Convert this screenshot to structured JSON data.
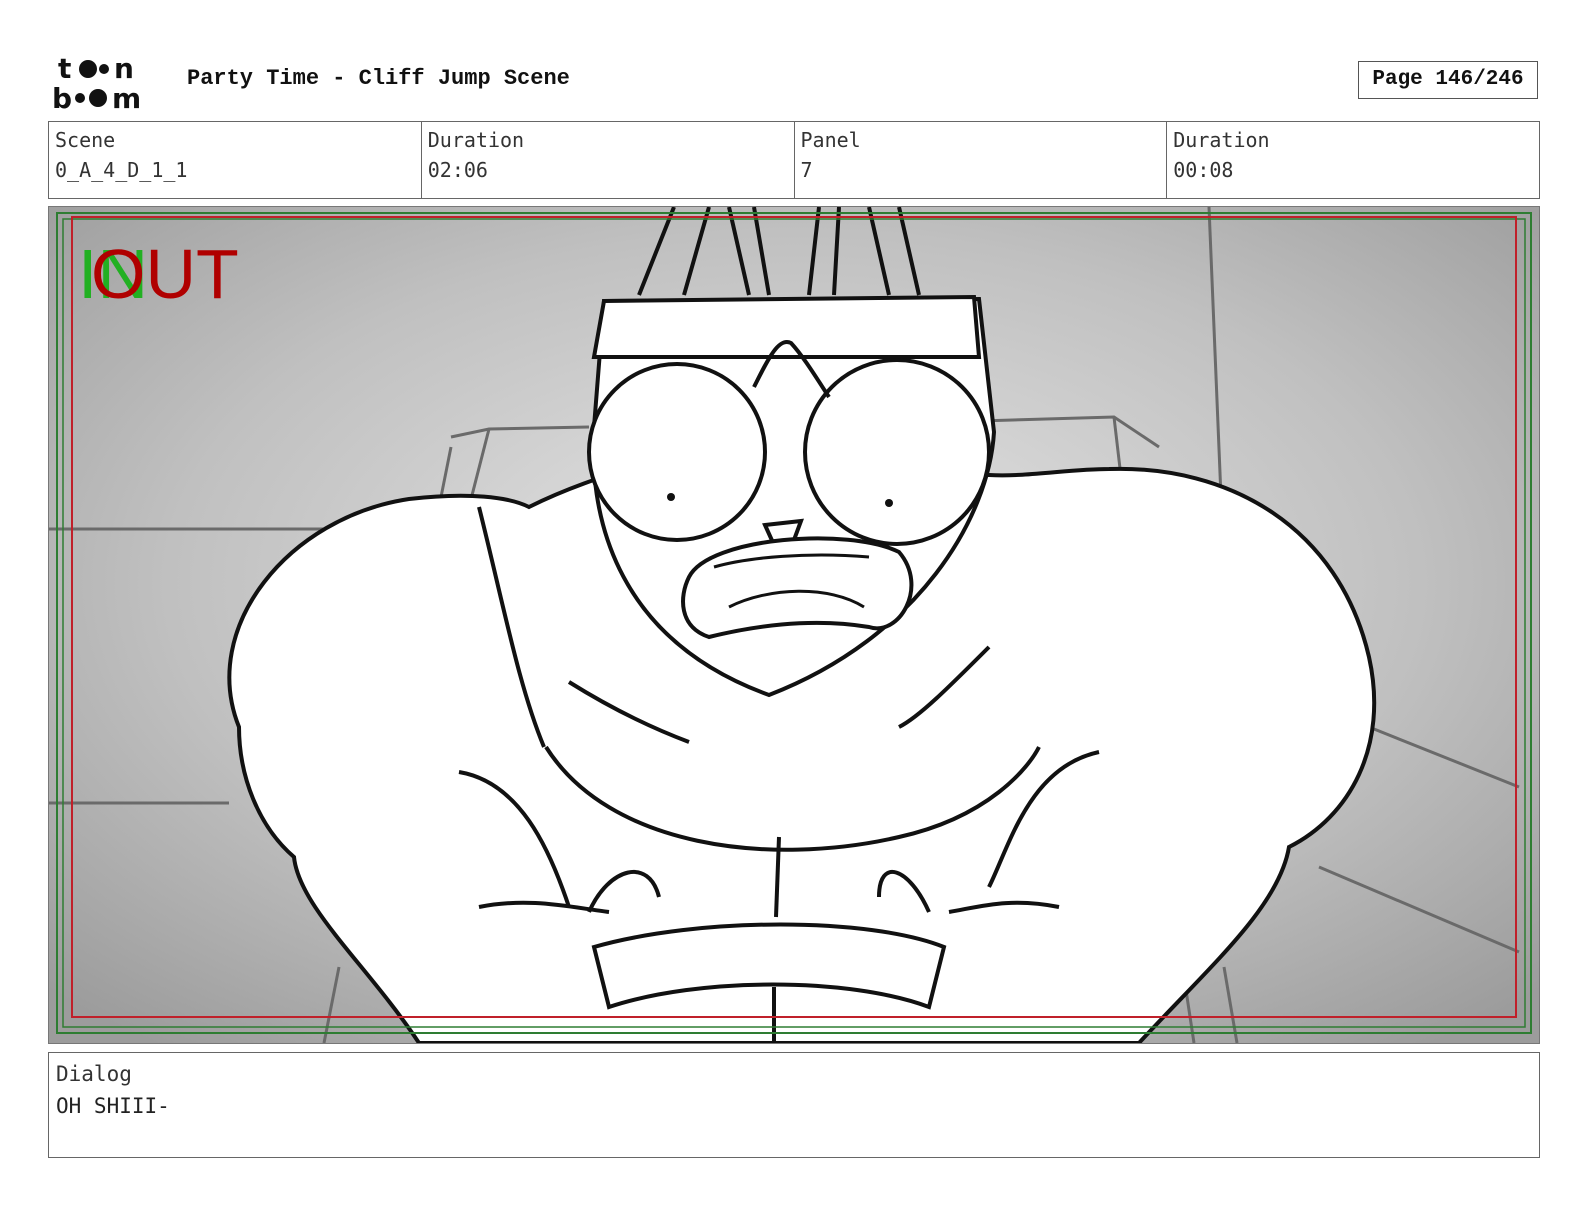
{
  "header": {
    "logo_text": "toon boom",
    "title": "Party Time - Cliff Jump Scene",
    "page": "Page 146/246"
  },
  "info": [
    {
      "label": "Scene",
      "value": "0_A_4_D_1_1"
    },
    {
      "label": "Duration",
      "value": "02:06"
    },
    {
      "label": "Panel",
      "value": "7"
    },
    {
      "label": "Duration",
      "value": "00:08"
    }
  ],
  "panel": {
    "in_marker": "IN",
    "out_marker": "OUT",
    "colors": {
      "in": "#22b022",
      "out": "#b00000",
      "frame_red": "#c0202a",
      "frame_green": "#2e7d32"
    }
  },
  "dialog": {
    "label": "Dialog",
    "text": "OH SHIII-"
  }
}
